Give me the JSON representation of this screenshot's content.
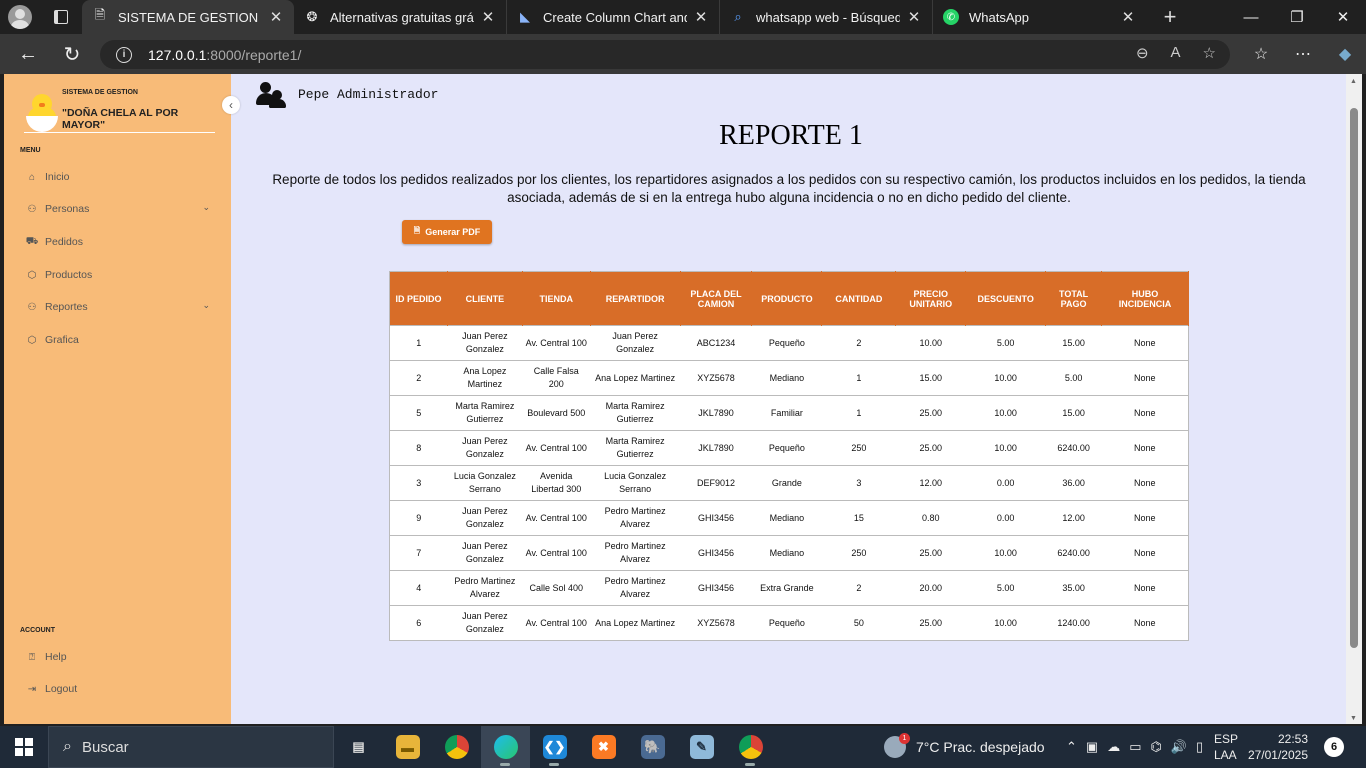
{
  "browser": {
    "tabs": [
      {
        "title": "SISTEMA DE GESTION",
        "icon": "document-icon",
        "active": true
      },
      {
        "title": "Alternativas gratuitas gráfica",
        "icon": "openai-icon"
      },
      {
        "title": "Create Column Chart and Gr",
        "icon": "chart-icon"
      },
      {
        "title": "whatsapp web - Búsqueda",
        "icon": "search-icon"
      },
      {
        "title": "WhatsApp",
        "icon": "whatsapp-icon"
      }
    ],
    "new_tab": "+",
    "url_host": "127.0.0.1",
    "url_path": ":8000/reporte1/"
  },
  "sidebar": {
    "logo_sub": "SISTEMA DE GESTION",
    "logo_title": "\"DOÑA CHELA AL POR MAYOR\"",
    "menu_label": "MENU",
    "items": [
      {
        "label": "Inicio",
        "icon": "home-icon"
      },
      {
        "label": "Personas",
        "icon": "person-icon",
        "has_submenu": true
      },
      {
        "label": "Pedidos",
        "icon": "truck-icon"
      },
      {
        "label": "Productos",
        "icon": "box-icon"
      },
      {
        "label": "Reportes",
        "icon": "person-icon",
        "has_submenu": true
      },
      {
        "label": "Grafica",
        "icon": "box-icon"
      }
    ],
    "account_label": "ACCOUNT",
    "account_items": [
      {
        "label": "Help",
        "icon": "help-icon"
      },
      {
        "label": "Logout",
        "icon": "logout-icon"
      }
    ]
  },
  "header": {
    "user_name": "Pepe Administrador"
  },
  "main": {
    "title": "REPORTE 1",
    "description": "Reporte de todos los pedidos realizados por los clientes, los repartidores asignados a los pedidos con su respectivo camión, los productos incluidos en los pedidos, la tienda asociada, además de si en la entrega hubo alguna incidencia o no en dicho pedido del cliente.",
    "pdf_button": "Generar PDF"
  },
  "table": {
    "headers": [
      "ID PEDIDO",
      "CLIENTE",
      "TIENDA",
      "REPARTIDOR",
      "PLACA DEL CAMION",
      "PRODUCTO",
      "CANTIDAD",
      "PRECIO UNITARIO",
      "DESCUENTO",
      "TOTAL PAGO",
      "HUBO INCIDENCIA"
    ],
    "rows": [
      [
        "1",
        "Juan Perez Gonzalez",
        "Av. Central 100",
        "Juan Perez Gonzalez",
        "ABC1234",
        "Pequeño",
        "2",
        "10.00",
        "5.00",
        "15.00",
        "None"
      ],
      [
        "2",
        "Ana Lopez Martinez",
        "Calle Falsa 200",
        "Ana Lopez Martinez",
        "XYZ5678",
        "Mediano",
        "1",
        "15.00",
        "10.00",
        "5.00",
        "None"
      ],
      [
        "5",
        "Marta Ramirez Gutierrez",
        "Boulevard 500",
        "Marta Ramirez Gutierrez",
        "JKL7890",
        "Familiar",
        "1",
        "25.00",
        "10.00",
        "15.00",
        "None"
      ],
      [
        "8",
        "Juan Perez Gonzalez",
        "Av. Central 100",
        "Marta Ramirez Gutierrez",
        "JKL7890",
        "Pequeño",
        "250",
        "25.00",
        "10.00",
        "6240.00",
        "None"
      ],
      [
        "3",
        "Lucia Gonzalez Serrano",
        "Avenida Libertad 300",
        "Lucia Gonzalez Serrano",
        "DEF9012",
        "Grande",
        "3",
        "12.00",
        "0.00",
        "36.00",
        "None"
      ],
      [
        "9",
        "Juan Perez Gonzalez",
        "Av. Central 100",
        "Pedro Martinez Alvarez",
        "GHI3456",
        "Mediano",
        "15",
        "0.80",
        "0.00",
        "12.00",
        "None"
      ],
      [
        "7",
        "Juan Perez Gonzalez",
        "Av. Central 100",
        "Pedro Martinez Alvarez",
        "GHI3456",
        "Mediano",
        "250",
        "25.00",
        "10.00",
        "6240.00",
        "None"
      ],
      [
        "4",
        "Pedro Martinez Alvarez",
        "Calle Sol 400",
        "Pedro Martinez Alvarez",
        "GHI3456",
        "Extra Grande",
        "2",
        "20.00",
        "5.00",
        "35.00",
        "None"
      ],
      [
        "6",
        "Juan Perez Gonzalez",
        "Av. Central 100",
        "Ana Lopez Martinez",
        "XYZ5678",
        "Pequeño",
        "50",
        "25.00",
        "10.00",
        "1240.00",
        "None"
      ]
    ]
  },
  "taskbar": {
    "search_placeholder": "Buscar",
    "weather_badge": "1",
    "weather": "7°C  Prac. despejado",
    "lang_line1": "ESP",
    "lang_line2": "LAA",
    "time": "22:53",
    "date": "27/01/2025",
    "notifications": "6"
  },
  "colors": {
    "sidebar": "#f8bb78",
    "page_bg": "#e4e6fa",
    "table_header": "#d86d28",
    "pdf_button": "#e07420"
  }
}
